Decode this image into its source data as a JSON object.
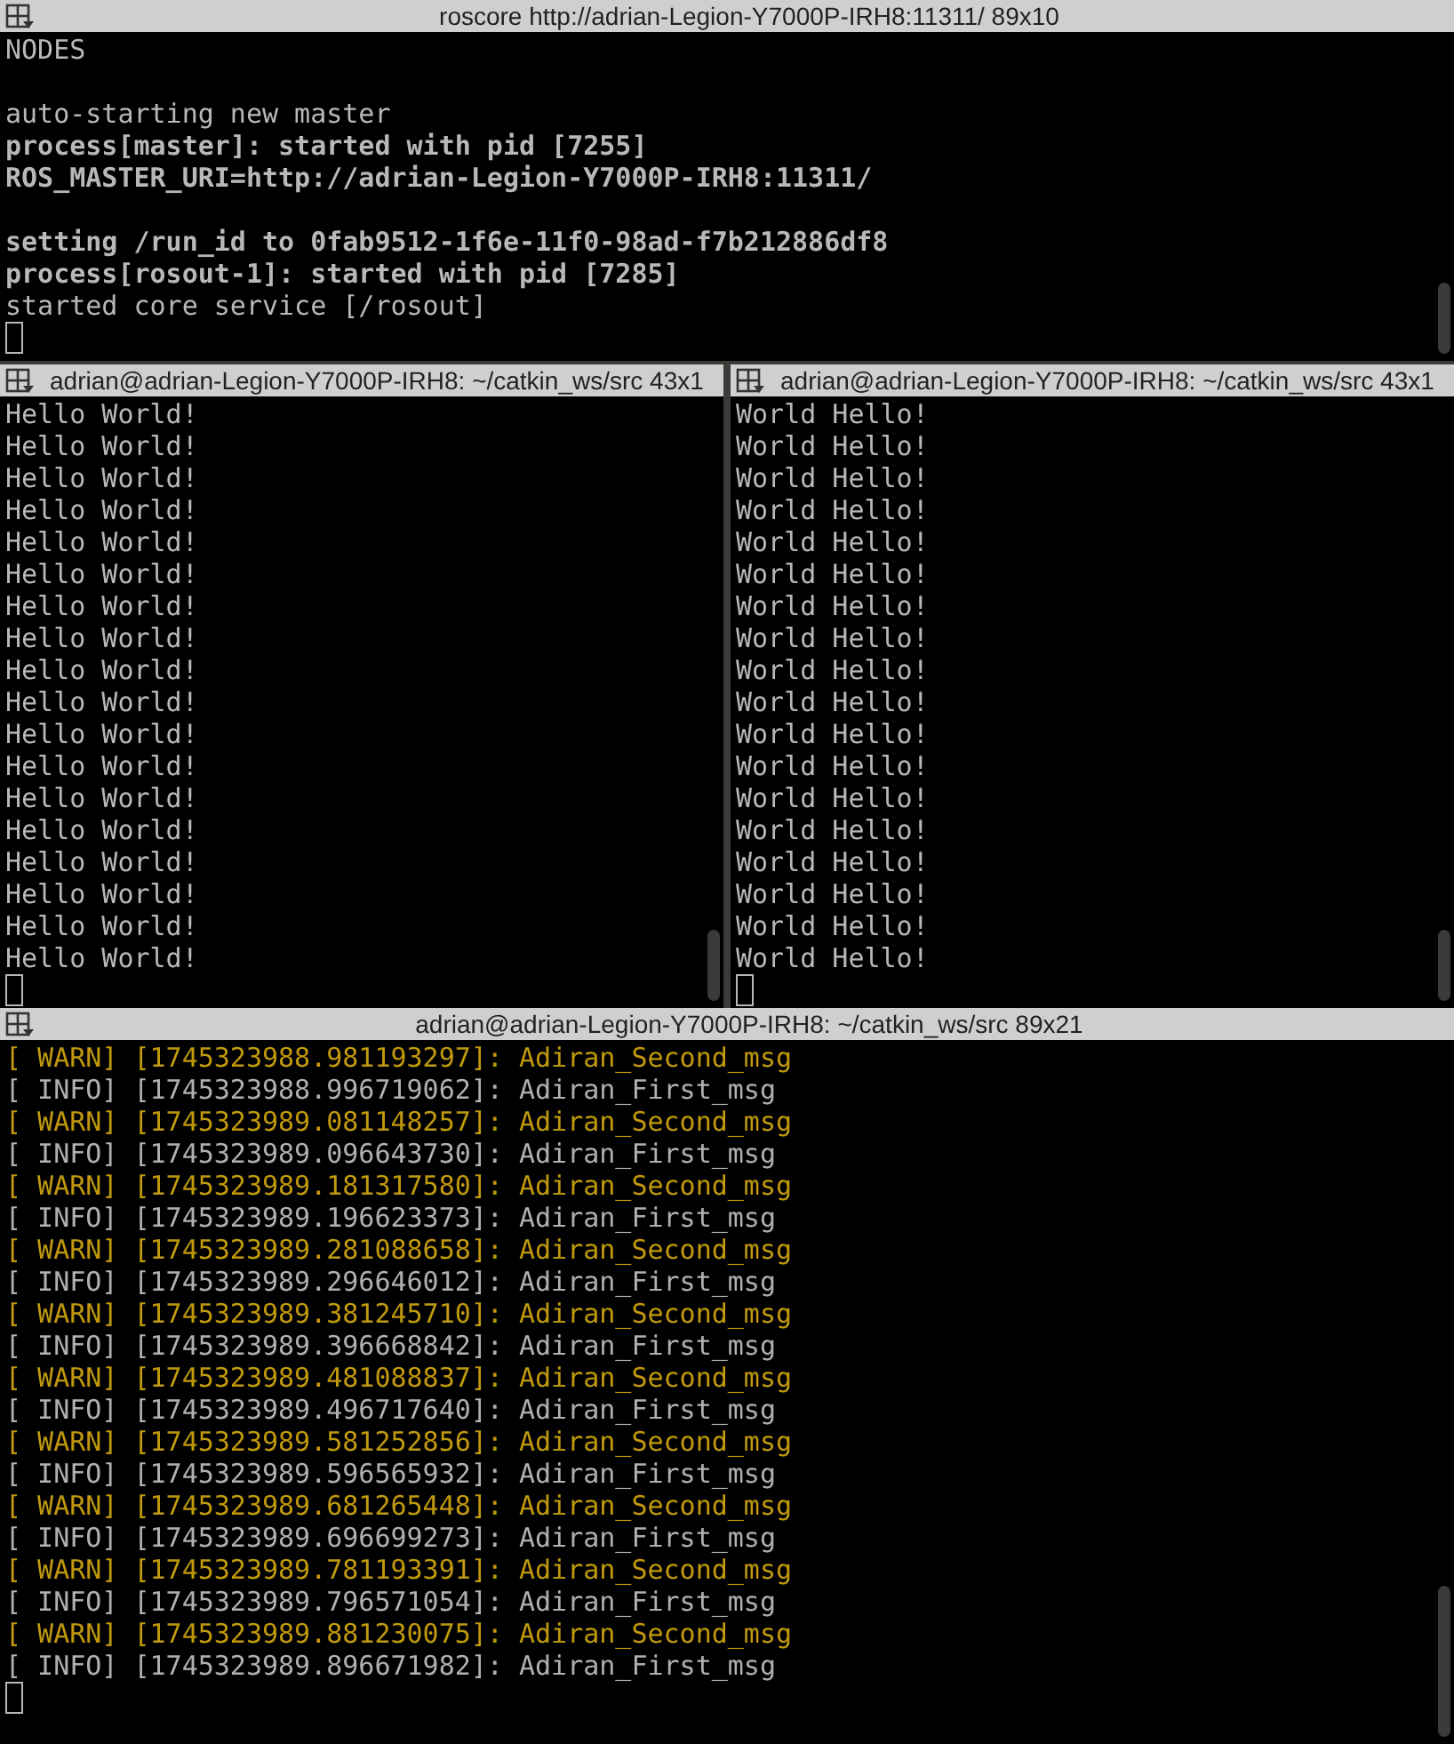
{
  "top_pane": {
    "title": "roscore http://adrian-Legion-Y7000P-IRH8:11311/ 89x10",
    "blocks": [
      [
        {
          "text": "NODES",
          "bold": false
        }
      ],
      [
        {
          "text": "auto-starting new master",
          "bold": false
        },
        {
          "text": "process[master]: started with pid [7255]",
          "bold": true
        },
        {
          "text": "ROS_MASTER_URI=http://adrian-Legion-Y7000P-IRH8:11311/",
          "bold": true
        }
      ],
      [
        {
          "text": "setting /run_id to 0fab9512-1f6e-11f0-98ad-f7b212886df8",
          "bold": true
        },
        {
          "text": "process[rosout-1]: started with pid [7285]",
          "bold": true
        },
        {
          "text": "started core service [/rosout]",
          "bold": false
        }
      ]
    ]
  },
  "middle_panes": [
    {
      "title": "adrian@adrian-Legion-Y7000P-IRH8: ~/catkin_ws/src 43x1",
      "lines": [
        "Hello World!",
        "Hello World!",
        "Hello World!",
        "Hello World!",
        "Hello World!",
        "Hello World!",
        "Hello World!",
        "Hello World!",
        "Hello World!",
        "Hello World!",
        "Hello World!",
        "Hello World!",
        "Hello World!",
        "Hello World!",
        "Hello World!",
        "Hello World!",
        "Hello World!",
        "Hello World!"
      ]
    },
    {
      "title": "adrian@adrian-Legion-Y7000P-IRH8: ~/catkin_ws/src 43x1",
      "lines": [
        "World Hello!",
        "World Hello!",
        "World Hello!",
        "World Hello!",
        "World Hello!",
        "World Hello!",
        "World Hello!",
        "World Hello!",
        "World Hello!",
        "World Hello!",
        "World Hello!",
        "World Hello!",
        "World Hello!",
        "World Hello!",
        "World Hello!",
        "World Hello!",
        "World Hello!",
        "World Hello!"
      ]
    }
  ],
  "bottom_pane": {
    "title": "adrian@adrian-Legion-Y7000P-IRH8: ~/catkin_ws/src 89x21",
    "lines": [
      {
        "kind": "warn",
        "text": "[ WARN] [1745323988.981193297]: Adiran_Second_msg"
      },
      {
        "kind": "info",
        "text": "[ INFO] [1745323988.996719062]: Adiran_First_msg"
      },
      {
        "kind": "warn",
        "text": "[ WARN] [1745323989.081148257]: Adiran_Second_msg"
      },
      {
        "kind": "info",
        "text": "[ INFO] [1745323989.096643730]: Adiran_First_msg"
      },
      {
        "kind": "warn",
        "text": "[ WARN] [1745323989.181317580]: Adiran_Second_msg"
      },
      {
        "kind": "info",
        "text": "[ INFO] [1745323989.196623373]: Adiran_First_msg"
      },
      {
        "kind": "warn",
        "text": "[ WARN] [1745323989.281088658]: Adiran_Second_msg"
      },
      {
        "kind": "info",
        "text": "[ INFO] [1745323989.296646012]: Adiran_First_msg"
      },
      {
        "kind": "warn",
        "text": "[ WARN] [1745323989.381245710]: Adiran_Second_msg"
      },
      {
        "kind": "info",
        "text": "[ INFO] [1745323989.396668842]: Adiran_First_msg"
      },
      {
        "kind": "warn",
        "text": "[ WARN] [1745323989.481088837]: Adiran_Second_msg"
      },
      {
        "kind": "info",
        "text": "[ INFO] [1745323989.496717640]: Adiran_First_msg"
      },
      {
        "kind": "warn",
        "text": "[ WARN] [1745323989.581252856]: Adiran_Second_msg"
      },
      {
        "kind": "info",
        "text": "[ INFO] [1745323989.596565932]: Adiran_First_msg"
      },
      {
        "kind": "warn",
        "text": "[ WARN] [1745323989.681265448]: Adiran_Second_msg"
      },
      {
        "kind": "info",
        "text": "[ INFO] [1745323989.696699273]: Adiran_First_msg"
      },
      {
        "kind": "warn",
        "text": "[ WARN] [1745323989.781193391]: Adiran_Second_msg"
      },
      {
        "kind": "info",
        "text": "[ INFO] [1745323989.796571054]: Adiran_First_msg"
      },
      {
        "kind": "warn",
        "text": "[ WARN] [1745323989.881230075]: Adiran_Second_msg"
      },
      {
        "kind": "info",
        "text": "[ INFO] [1745323989.896671982]: Adiran_First_msg"
      }
    ]
  }
}
